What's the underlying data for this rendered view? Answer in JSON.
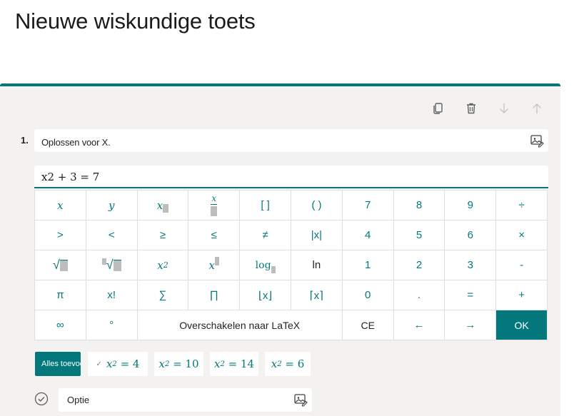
{
  "page": {
    "title": "Nieuwe wiskundige toets"
  },
  "question": {
    "number": "1.",
    "text": "Oplossen voor X.",
    "formula": "x2 + 3 = 7"
  },
  "keypad": {
    "rows": [
      [
        "x",
        "y",
        "x□",
        "x/□",
        "[ ]",
        "( )",
        "7",
        "8",
        "9",
        "÷"
      ],
      [
        ">",
        "<",
        "≥",
        "≤",
        "≠",
        "|x|",
        "4",
        "5",
        "6",
        "×"
      ],
      [
        "√□",
        "□√□",
        "x²",
        "x□",
        "log□",
        "ln",
        "1",
        "2",
        "3",
        "-"
      ],
      [
        "π",
        "x!",
        "∑",
        "∏",
        "⌊x⌋",
        "⌈x⌉",
        "0",
        ".",
        "=",
        "+"
      ],
      [
        "∞",
        "°",
        "Overschakelen naar LaTeX",
        "CE",
        "←",
        "→",
        "OK"
      ]
    ],
    "labels": {
      "x": "x",
      "y": "y",
      "brackets": "[ ]",
      "parens": "( )",
      "n7": "7",
      "n8": "8",
      "n9": "9",
      "divide": "÷",
      "gt": ">",
      "lt": "<",
      "ge": "≥",
      "le": "≤",
      "ne": "≠",
      "abs": "|x|",
      "n4": "4",
      "n5": "5",
      "n6": "6",
      "times": "×",
      "sqrt": "√",
      "power_base": "x",
      "power_exp": "2",
      "log": "log",
      "ln": "ln",
      "n1": "1",
      "n2": "2",
      "n3": "3",
      "minus": "-",
      "pi": "π",
      "factorial": "x!",
      "sum": "∑",
      "product": "∏",
      "floor": "⌊x⌋",
      "ceil": "⌈x⌉",
      "n0": "0",
      "dot": ".",
      "equals": "=",
      "plus": "+",
      "infinity": "∞",
      "degree": "°",
      "latex_switch": "Overschakelen naar LaTeX",
      "clear": "CE",
      "left": "←",
      "right": "→",
      "ok": "OK"
    }
  },
  "answers": {
    "add_all": "Alles toevoegen",
    "chips": [
      {
        "var": "x",
        "sub": "2",
        "rest": "= 4"
      },
      {
        "var": "x",
        "sub": "2",
        "rest": "= 10"
      },
      {
        "var": "x",
        "sub": "2",
        "rest": "= 14"
      },
      {
        "var": "x",
        "sub": "2",
        "rest": "= 6"
      }
    ]
  },
  "option": {
    "text": "Optie"
  },
  "colors": {
    "accent": "#03787c",
    "card": "#f3f2f1",
    "key_border": "#e1dfdd"
  },
  "icons": [
    "copy-icon",
    "trash-icon",
    "arrow-down-icon",
    "arrow-up-icon",
    "image-icon",
    "check-circle-icon"
  ]
}
